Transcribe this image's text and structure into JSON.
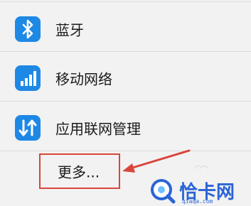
{
  "items": [
    {
      "label": "蓝牙",
      "icon": "bluetooth-icon"
    },
    {
      "label": "移动网络",
      "icon": "signal-bars-icon"
    },
    {
      "label": "应用联网管理",
      "icon": "data-transfer-arrows-icon"
    }
  ],
  "more": {
    "label": "更多..."
  },
  "watermark": {
    "text": "恰卡网",
    "subtext": "qiaqa.com",
    "icon": "logo-icon"
  },
  "colors": {
    "icon_bg": "#1e88e5",
    "highlight": "#d9463c",
    "watermark": "#2a64d6",
    "background": "#f2f2f2"
  }
}
